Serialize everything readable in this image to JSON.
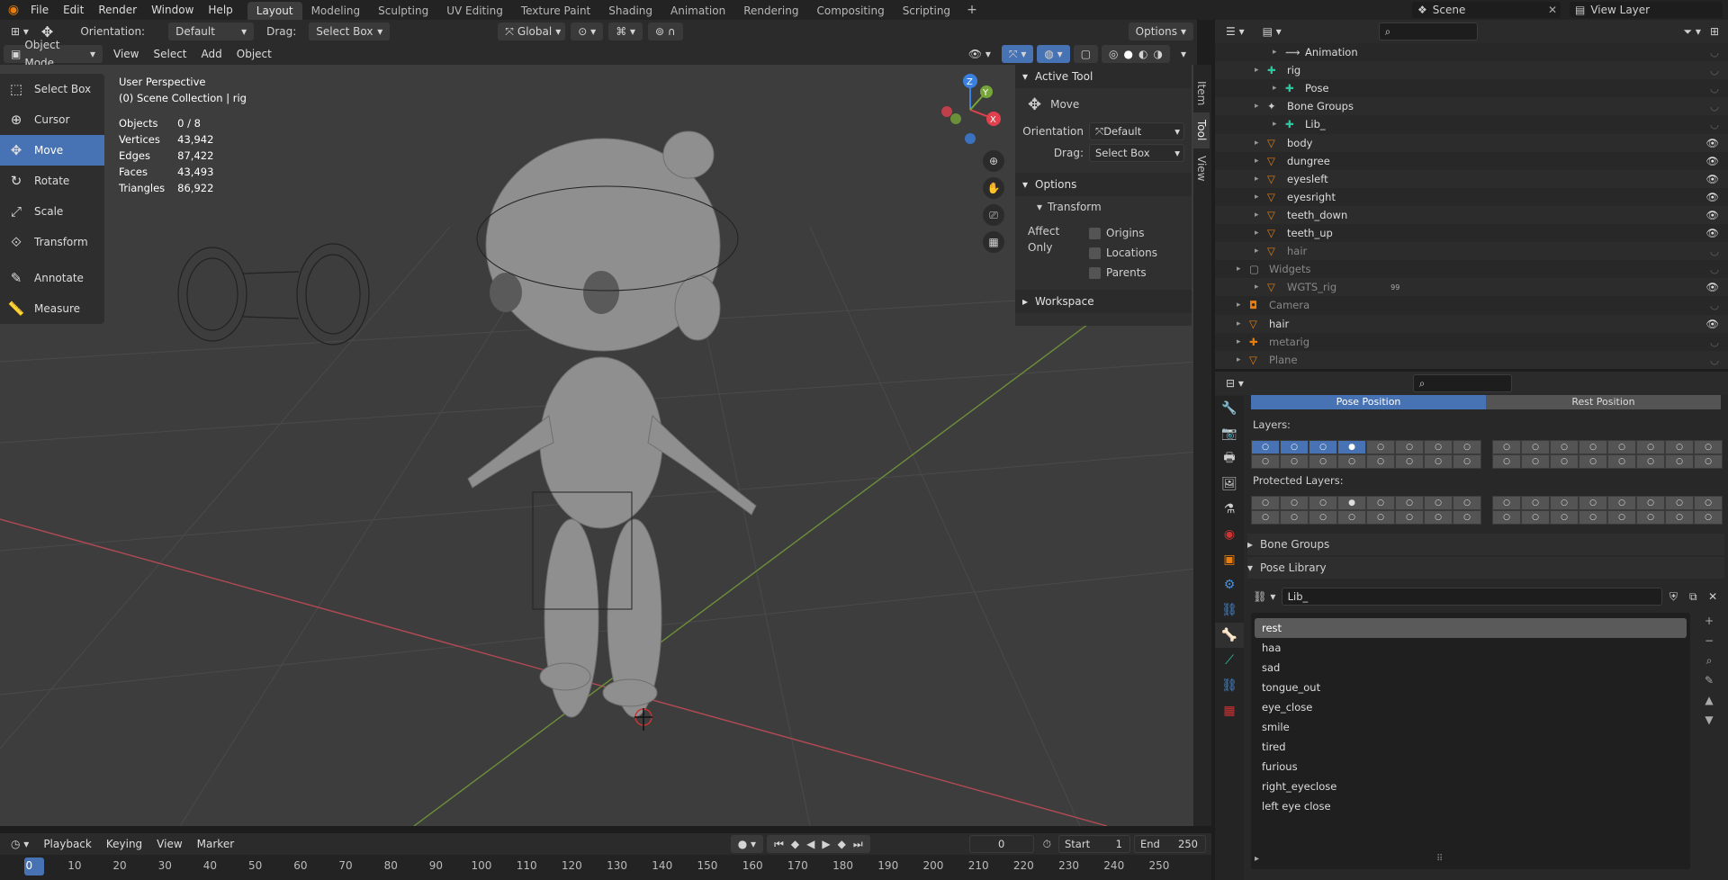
{
  "topbar": {
    "menus": [
      "File",
      "Edit",
      "Render",
      "Window",
      "Help"
    ],
    "workspaces": [
      "Layout",
      "Modeling",
      "Sculpting",
      "UV Editing",
      "Texture Paint",
      "Shading",
      "Animation",
      "Rendering",
      "Compositing",
      "Scripting"
    ],
    "add_tab": "+",
    "scene_label": "Scene",
    "view_layer_label": "View Layer"
  },
  "header3d": {
    "orientation_label": "Orientation:",
    "orientation_value": "Default",
    "drag_label": "Drag:",
    "drag_value": "Select Box",
    "transform_space": "Global",
    "options_label": "Options"
  },
  "header2": {
    "mode": "Object Mode",
    "menus": [
      "View",
      "Select",
      "Add",
      "Object"
    ]
  },
  "tools": [
    "Select Box",
    "Cursor",
    "Move",
    "Rotate",
    "Scale",
    "Transform",
    "Annotate",
    "Measure"
  ],
  "active_tool_index": 2,
  "viewport_info": {
    "perspective": "User Perspective",
    "collection": "(0) Scene Collection | rig",
    "stats": [
      {
        "label": "Objects",
        "value": "0 / 8"
      },
      {
        "label": "Vertices",
        "value": "43,942"
      },
      {
        "label": "Edges",
        "value": "87,422"
      },
      {
        "label": "Faces",
        "value": "43,493"
      },
      {
        "label": "Triangles",
        "value": "86,922"
      }
    ]
  },
  "gizmo": {
    "x": "X",
    "y": "Y",
    "z": "Z"
  },
  "npanel": {
    "active_tool_title": "Active Tool",
    "tool_name": "Move",
    "orientation_label": "Orientation",
    "orientation_value": "Default",
    "drag_label": "Drag:",
    "drag_value": "Select Box",
    "options_title": "Options",
    "transform_title": "Transform",
    "affect_only": "Affect Only",
    "origins": "Origins",
    "locations": "Locations",
    "parents": "Parents",
    "workspace_title": "Workspace",
    "tabs": [
      "Item",
      "Tool",
      "View"
    ]
  },
  "timeline": {
    "menus": [
      "Playback",
      "Keying",
      "View",
      "Marker"
    ],
    "current_frame": "0",
    "start_label": "Start",
    "start_value": "1",
    "end_label": "End",
    "end_value": "250",
    "ticks": [
      "0",
      "10",
      "20",
      "30",
      "40",
      "50",
      "60",
      "70",
      "80",
      "90",
      "100",
      "110",
      "120",
      "130",
      "140",
      "150",
      "160",
      "170",
      "180",
      "190",
      "200",
      "210",
      "220",
      "230",
      "240",
      "250"
    ]
  },
  "outliner": {
    "rows": [
      {
        "name": "Animation",
        "dim": false,
        "eye": false
      },
      {
        "name": "rig",
        "dim": false,
        "eye": false
      },
      {
        "name": "Pose",
        "dim": false,
        "eye": false
      },
      {
        "name": "Bone Groups",
        "dim": false,
        "eye": false
      },
      {
        "name": "Lib_",
        "dim": false,
        "eye": false
      },
      {
        "name": "body",
        "dim": false,
        "eye": true
      },
      {
        "name": "dungree",
        "dim": false,
        "eye": true
      },
      {
        "name": "eyesleft",
        "dim": false,
        "eye": true
      },
      {
        "name": "eyesright",
        "dim": false,
        "eye": true
      },
      {
        "name": "teeth_down",
        "dim": false,
        "eye": true
      },
      {
        "name": "teeth_up",
        "dim": false,
        "eye": true
      },
      {
        "name": "hair",
        "dim": true,
        "eye": false
      },
      {
        "name": "Widgets",
        "dim": true,
        "eye": false
      },
      {
        "name": "WGTS_rig",
        "dim": true,
        "eye": true
      },
      {
        "name": "Camera",
        "dim": true,
        "eye": false
      },
      {
        "name": "hair",
        "dim": false,
        "eye": true
      },
      {
        "name": "metarig",
        "dim": true,
        "eye": false
      },
      {
        "name": "Plane",
        "dim": true,
        "eye": false
      }
    ],
    "wgts_badge": "99"
  },
  "properties": {
    "pose_position": "Pose Position",
    "rest_position": "Rest Position",
    "layers_label": "Layers:",
    "protected_layers_label": "Protected Layers:",
    "bone_groups": "Bone Groups",
    "pose_library": "Pose Library",
    "library_name": "Lib_",
    "poses": [
      "rest",
      "haa",
      "sad",
      "tongue_out",
      "eye_close",
      "smile",
      "tired",
      "furious",
      "right_eyeclose",
      "left eye close"
    ],
    "selected_pose_index": 0
  },
  "colors": {
    "accent": "#4772b3",
    "viewport": "#3d3d3d",
    "x_axis": "#e0414d",
    "y_axis": "#76a63a",
    "z_axis": "#3a80e0"
  }
}
